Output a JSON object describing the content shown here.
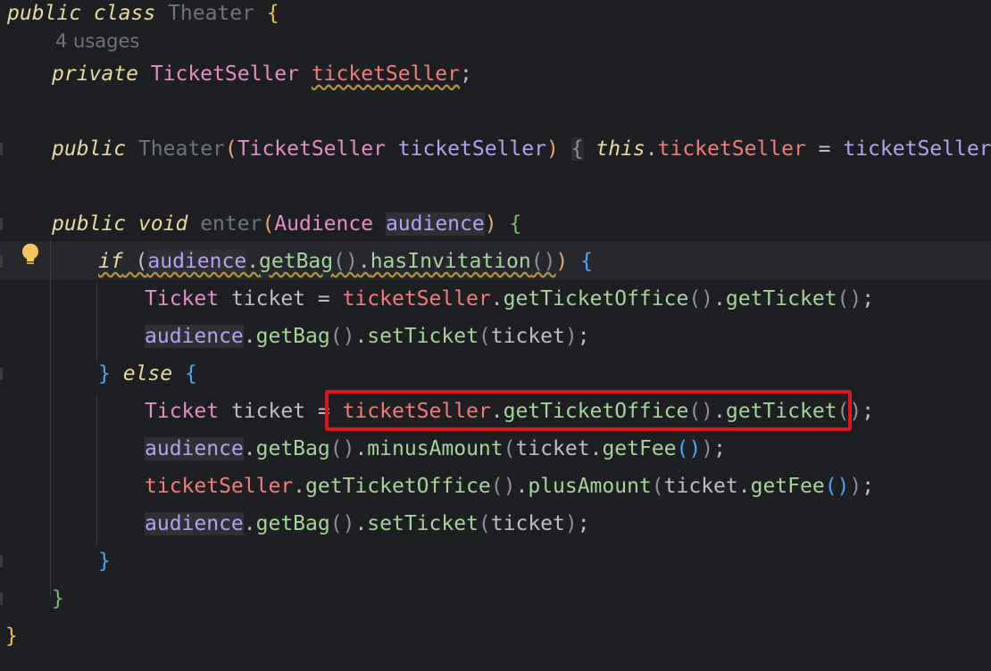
{
  "editor": {
    "usages_hint": "4 usages",
    "lines": {
      "l1": [
        "public class",
        " ",
        "Theater",
        " ",
        "{"
      ],
      "l3": [
        "private",
        " ",
        "TicketSeller",
        " ",
        "ticketSeller",
        ";"
      ],
      "l5": [
        "public",
        " ",
        "Theater",
        "(",
        "TicketSeller",
        " ",
        "ticketSeller",
        ")",
        " ",
        "{",
        " ",
        "this",
        ".",
        "ticketSeller",
        " = ",
        "ticketSeller",
        ";",
        " ",
        "}"
      ],
      "l7": [
        "public void",
        " ",
        "enter",
        "(",
        "Audience",
        " ",
        "audience",
        ")",
        " ",
        "{"
      ],
      "l8": [
        "if",
        " (",
        "audience",
        ".",
        "getBag",
        "()",
        ".",
        "hasInvitation",
        "()",
        ")",
        " ",
        "{"
      ],
      "l9": [
        "Ticket",
        " ticket = ",
        "ticketSeller",
        ".",
        "getTicketOffice",
        "()",
        ".",
        "getTicket",
        "()",
        ";"
      ],
      "l10": [
        "audience",
        ".",
        "getBag",
        "()",
        ".",
        "setTicket",
        "(",
        "ticket",
        ")",
        ";"
      ],
      "l11": [
        "}",
        " ",
        "else",
        " ",
        "{"
      ],
      "l12": [
        "Ticket",
        " ticket = ",
        "ticketSeller",
        ".",
        "getTicketOffice",
        "()",
        ".",
        "getTicket",
        "()",
        ";"
      ],
      "l13": [
        "audience",
        ".",
        "getBag",
        "()",
        ".",
        "minusAmount",
        "(",
        "ticket",
        ".",
        "getFee",
        "()",
        ")",
        ";"
      ],
      "l14": [
        "ticketSeller",
        ".",
        "getTicketOffice",
        "()",
        ".",
        "plusAmount",
        "(",
        "ticket",
        ".",
        "getFee",
        "()",
        ")",
        ";"
      ],
      "l15": [
        "audience",
        ".",
        "getBag",
        "()",
        ".",
        "setTicket",
        "(",
        "ticket",
        ")",
        ";"
      ],
      "l16": [
        "}"
      ],
      "l17": [
        "}"
      ],
      "l18": [
        "}"
      ]
    },
    "colors": {
      "background": "#1e1f22",
      "highlight_box": "#e0161b",
      "keyword": "#e8d9a0",
      "type": "#e58bc6",
      "field": "#f57a7a",
      "parameter": "#b89ef4",
      "method": "#a6d39a"
    },
    "icons": {
      "intention_bulb": "lightbulb-icon"
    }
  }
}
